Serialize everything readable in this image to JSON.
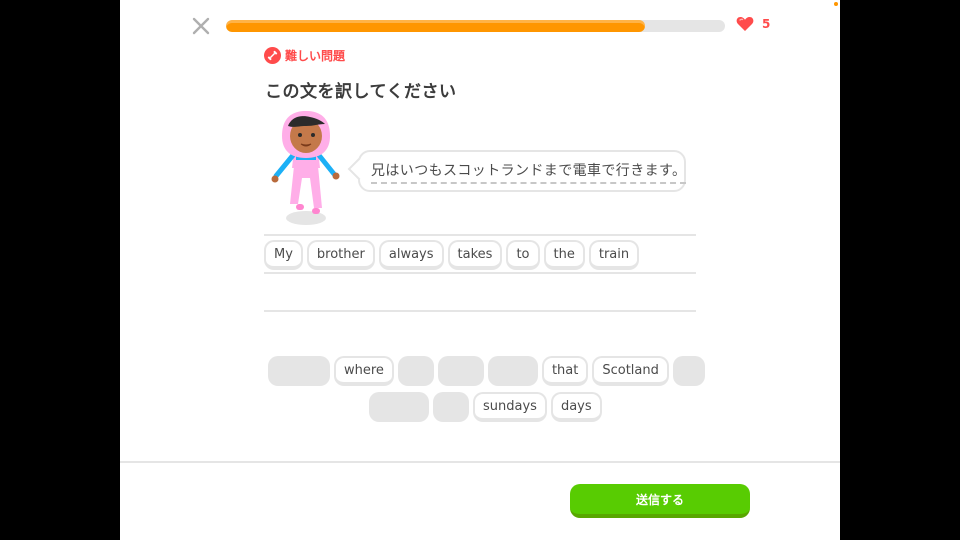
{
  "header": {
    "close_icon": "close-icon",
    "progress_fraction": 0.84,
    "hearts_count": "5",
    "heart_color": "#ff4b4b",
    "progress_color": "#ff9600"
  },
  "badge": {
    "label": "難しい問題",
    "icon": "dumbbell-icon"
  },
  "prompt": {
    "title": "この文を訳してください"
  },
  "speech": {
    "text": "兄はいつもスコットランドまで電車で行きます。"
  },
  "answer": {
    "words": [
      "My",
      "brother",
      "always",
      "takes",
      "to",
      "the",
      "train"
    ]
  },
  "word_bank": {
    "row1": [
      {
        "label": "",
        "used": true,
        "w": 62
      },
      {
        "label": "where",
        "used": false
      },
      {
        "label": "",
        "used": true,
        "w": 36
      },
      {
        "label": "",
        "used": true,
        "w": 46
      },
      {
        "label": "",
        "used": true,
        "w": 50
      },
      {
        "label": "that",
        "used": false
      },
      {
        "label": "Scotland",
        "used": false
      },
      {
        "label": "",
        "used": true,
        "w": 32
      }
    ],
    "row2": [
      {
        "label": "",
        "used": true,
        "w": 60
      },
      {
        "label": "",
        "used": true,
        "w": 36
      },
      {
        "label": "sundays",
        "used": false
      },
      {
        "label": "days",
        "used": false
      }
    ]
  },
  "footer": {
    "submit_label": "送信する",
    "submit_color": "#58cc02"
  }
}
